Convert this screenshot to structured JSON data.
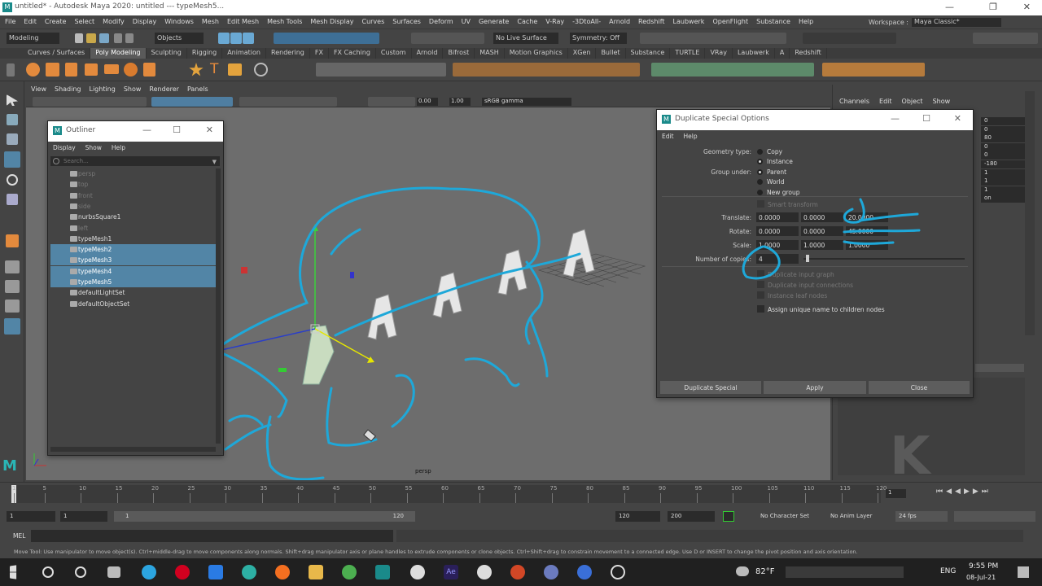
{
  "window": {
    "title": "untitled* - Autodesk Maya 2020: untitled   ---   typeMesh5..."
  },
  "menubar": [
    "File",
    "Edit",
    "Create",
    "Select",
    "Modify",
    "Display",
    "Windows",
    "Mesh",
    "Edit Mesh",
    "Mesh Tools",
    "Mesh Display",
    "Curves",
    "Surfaces",
    "Deform",
    "UV",
    "Generate",
    "Cache",
    "V-Ray",
    "-3DtoAll-",
    "Arnold",
    "Redshift",
    "Laubwerk",
    "OpenFlight",
    "Substance",
    "Help"
  ],
  "workspace": {
    "label": "Workspace :",
    "value": "Maya Classic*"
  },
  "statusline": {
    "mode": "Modeling",
    "objects": "Objects",
    "live_surface": "No Live Surface",
    "symmetry": "Symmetry: Off"
  },
  "shelf_tabs": [
    {
      "label": "Curves / Surfaces",
      "active": false
    },
    {
      "label": "Poly Modeling",
      "active": true
    },
    {
      "label": "Sculpting",
      "active": false
    },
    {
      "label": "Rigging",
      "active": false
    },
    {
      "label": "Animation",
      "active": false
    },
    {
      "label": "Rendering",
      "active": false
    },
    {
      "label": "FX",
      "active": false
    },
    {
      "label": "FX Caching",
      "active": false
    },
    {
      "label": "Custom",
      "active": false
    },
    {
      "label": "Arnold",
      "active": false
    },
    {
      "label": "Bifrost",
      "active": false
    },
    {
      "label": "MASH",
      "active": false
    },
    {
      "label": "Motion Graphics",
      "active": false
    },
    {
      "label": "XGen",
      "active": false
    },
    {
      "label": "Bullet",
      "active": false
    },
    {
      "label": "Substance",
      "active": false
    },
    {
      "label": "TURTLE",
      "active": false
    },
    {
      "label": "VRay",
      "active": false
    },
    {
      "label": "Laubwerk",
      "active": false
    },
    {
      "label": "A",
      "active": false
    },
    {
      "label": "Redshift",
      "active": false
    }
  ],
  "viewport": {
    "menu": [
      "View",
      "Shading",
      "Lighting",
      "Show",
      "Renderer",
      "Panels"
    ],
    "near": "0.00",
    "far": "1.00",
    "colorspace": "sRGB gamma",
    "camera_label": "persp"
  },
  "outliner": {
    "title": "Outliner",
    "menu": [
      "Display",
      "Show",
      "Help"
    ],
    "search_placeholder": "Search...",
    "items": [
      {
        "label": "persp",
        "state": "dim"
      },
      {
        "label": "top",
        "state": "dim"
      },
      {
        "label": "front",
        "state": "dim"
      },
      {
        "label": "side",
        "state": "dim"
      },
      {
        "label": "nurbsSquare1",
        "state": "normal"
      },
      {
        "label": "left",
        "state": "dim"
      },
      {
        "label": "typeMesh1",
        "state": "normal"
      },
      {
        "label": "typeMesh2",
        "state": "sel"
      },
      {
        "label": "typeMesh3",
        "state": "sel"
      },
      {
        "label": "typeMesh4",
        "state": "sel"
      },
      {
        "label": "typeMesh5",
        "state": "sel"
      },
      {
        "label": "defaultLightSet",
        "state": "normal"
      },
      {
        "label": "defaultObjectSet",
        "state": "normal"
      }
    ]
  },
  "dialog": {
    "title": "Duplicate Special Options",
    "menu": [
      "Edit",
      "Help"
    ],
    "geometry_type_label": "Geometry type:",
    "geometry_type_options": [
      {
        "label": "Copy",
        "selected": false
      },
      {
        "label": "Instance",
        "selected": true
      }
    ],
    "group_under_label": "Group under:",
    "group_under_options": [
      {
        "label": "Parent",
        "selected": true
      },
      {
        "label": "World",
        "selected": false
      },
      {
        "label": "New group",
        "selected": false
      }
    ],
    "smart_transform": "Smart transform",
    "translate_label": "Translate:",
    "translate": [
      "0.0000",
      "0.0000",
      "20.0000"
    ],
    "rotate_label": "Rotate:",
    "rotate": [
      "0.0000",
      "0.0000",
      "45.0000"
    ],
    "scale_label": "Scale:",
    "scale": [
      "1.0000",
      "1.0000",
      "1.0000"
    ],
    "copies_label": "Number of copies:",
    "copies": "4",
    "checks": [
      "Duplicate input graph",
      "Duplicate input connections",
      "Instance leaf nodes",
      "Assign unique name to children nodes"
    ],
    "buttons": {
      "duplicate": "Duplicate Special",
      "apply": "Apply",
      "close": "Close"
    }
  },
  "channelbox": {
    "menu": [
      "Channels",
      "Edit",
      "Object",
      "Show"
    ],
    "values": [
      "0",
      "0",
      "80",
      "0",
      "0",
      "-180",
      "1",
      "1",
      "1",
      "on"
    ],
    "side_tabs": [
      "Channel Box / Layer Editor",
      "Modeling Toolkit",
      "Human IK",
      "Attribute Editor"
    ]
  },
  "timeslider": {
    "ticks": [
      "1",
      "5",
      "10",
      "15",
      "20",
      "25",
      "30",
      "35",
      "40",
      "45",
      "50",
      "55",
      "60",
      "65",
      "70",
      "75",
      "80",
      "85",
      "90",
      "95",
      "100",
      "105",
      "110",
      "115",
      "120"
    ],
    "current": "1"
  },
  "range": {
    "start": "1",
    "start2": "1",
    "slider_start": "1",
    "slider_end": "120",
    "end": "120",
    "end2": "200",
    "char_set": "No Character Set",
    "anim_layer": "No Anim Layer",
    "fps": "24 fps"
  },
  "mel": {
    "label": "MEL"
  },
  "helpline": "Move Tool: Use manipulator to move object(s). Ctrl+middle-drag to move components along normals. Shift+drag manipulator axis or plane handles to extrude components or clone objects. Ctrl+Shift+drag to constrain movement to a connected edge. Use D or INSERT to change the pivot position and axis orientation.",
  "taskbar": {
    "weather": "82°F",
    "lang": "ENG",
    "time": "9:55 PM",
    "date": "08-Jul-21"
  },
  "colors": {
    "accent_blue": "#1ea8d9",
    "selection": "#5285a6",
    "maya_teal": "#1a8a8a"
  }
}
